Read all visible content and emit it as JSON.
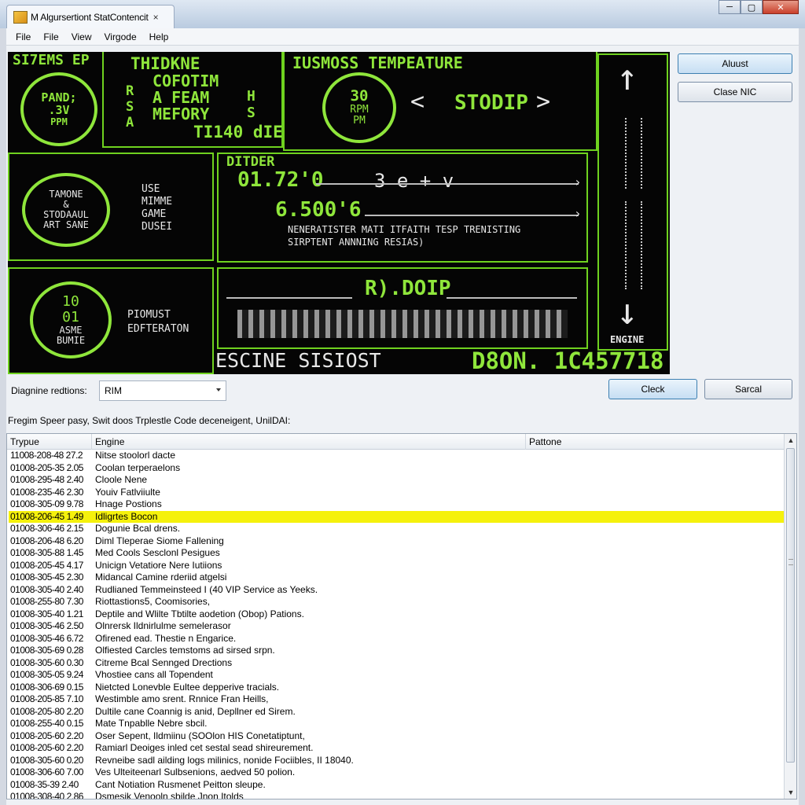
{
  "window": {
    "tab_title": "M Algursertiont StatContencit",
    "tab_close": "×",
    "min": "─",
    "max": "▢",
    "close": "✕"
  },
  "menu": [
    "File",
    "File",
    "View",
    "Virgode",
    "Help"
  ],
  "screen": {
    "p1_title": "SI7EMS EP",
    "p1_gauge": [
      "PAND;",
      ".3V",
      "PPM"
    ],
    "p1b_title": "THIDKNE",
    "p1b_lines": [
      "COFOTIM",
      "A FEAM",
      "MEFORY"
    ],
    "p1b_left": [
      "R",
      "S",
      "A"
    ],
    "p1b_right": [
      "H",
      "S"
    ],
    "p1b_bottom": "TI140 dIE",
    "p2_title": "IUSMOSS TEMPEATURE",
    "p2_gauge": [
      "30",
      "RPM",
      "PM"
    ],
    "p2_stop": "STODIP",
    "p3_gauge": [
      "TAMONE",
      "&",
      "STODAAUL",
      "ART SANE"
    ],
    "p3_text": [
      "USE",
      "MIMME",
      "GAME",
      "DUSEI"
    ],
    "p4_title": "DITDER",
    "p4_val1": "01.72'0",
    "p4_val2": "6.500'6",
    "p4_mid": "3 e + v",
    "p4_line1": "NENERATISTER MATI ITFAITH TESP TRENISTING",
    "p4_line2": "SIRPTENT ANNNING RESIAS)",
    "p5_gauge": [
      "10",
      "01",
      "ASME",
      "BUMIE"
    ],
    "p5_text": [
      "PIOMUST",
      "EDFTERATON"
    ],
    "p6_title": "R).DOIP",
    "side_label": "ENGINE",
    "bottom_left": "ESCINE SISIOST",
    "bottom_right": "D8ON. 1C457718"
  },
  "buttons": {
    "adjust": "Aluust",
    "close_nic": "Clase NIC",
    "check": "Cleck",
    "search": "Sarcal"
  },
  "diagnose": {
    "label": "Diagnine redtions:",
    "value": "RIM"
  },
  "info_line": "Fregim Speer pasy, Swit doos Trplestle Code deceneigent, UnilDAI:",
  "list": {
    "columns": [
      "Trypue",
      "Engine",
      "Pattone"
    ],
    "rows": [
      [
        "11008-208-48 27.2",
        "Nitse stoolorl dacte"
      ],
      [
        "01008-205-35 2.05",
        "Coolan terperaelons"
      ],
      [
        "01008-295-48 2.40",
        "Cloole Nene"
      ],
      [
        "01008-235-46 2.30",
        "Youiv Fatlviiulte"
      ],
      [
        "01008-305-09 9.78",
        "Hnage Postions"
      ],
      [
        "01008-206-45 1.49",
        "Idligrtes Bocon"
      ],
      [
        "01008-306-46 2.15",
        "Dogunie Bcal drens."
      ],
      [
        "01008-206-48 6.20",
        "Diml Tleperae Siome Fallening"
      ],
      [
        "01008-305-88 1.45",
        "Med Cools Sesclonl Pesigues"
      ],
      [
        "01008-205-45 4.17",
        "Unicign Vetatiore Nere Iutiions"
      ],
      [
        "01008-305-45 2.30",
        "Midancal Camine rderiid atgelsi"
      ],
      [
        "01008-305-40 2.40",
        "Rudlianed Temmeinsteed I (40 VIP Service as Yeeks."
      ],
      [
        "01008-255-80 7.30",
        "Riottastions5, Coomisories,"
      ],
      [
        "01008-305-40 1.21",
        "Deptile and Wlilte Tbtilte aodetion (Obop) Pations."
      ],
      [
        "01008-305-46 2.50",
        "Olnrersk Ildnirlulme semelerasor"
      ],
      [
        "01008-305-46 6.72",
        "Ofirened ead. Thestie n Engarice."
      ],
      [
        "01008-305-69 0.28",
        "Olfiested Carcles temstoms ad sirsed srpn."
      ],
      [
        "01008-305-60 0.30",
        "Citreme Bcal Sennged Drections"
      ],
      [
        "01008-305-05 9.24",
        "Vhostiee cans all Topendent"
      ],
      [
        "01008-306-69 0.15",
        "Nietcted Lonevble Eultee depperive tracials."
      ],
      [
        "01008-205-85 7.10",
        "Westimble amo srent. Rnnice Fran Heills,"
      ],
      [
        "01008-205-80 2.20",
        "Dultile cane Coannig is anid, Depllner ed Sirem."
      ],
      [
        "01008-255-40 0.15",
        "Mate Tnpablle Nebre sbcil."
      ],
      [
        "01008-205-60 2.20",
        "Oser Sepent, Ildmiinu (SOOlon HIS Conetatiptunt,"
      ],
      [
        "01008-205-60 2.20",
        "Ramiarl Deoiges inled cet sestal sead shireurement."
      ],
      [
        "01008-305-60 0.20",
        "Revneibe sadl ailding logs milinics, nonide Fociibles, II 18040."
      ],
      [
        "01008-306-60 7.00",
        "Ves Ulteiteenarl Sulbsenions, aedved 50 polion."
      ],
      [
        "01008-35-39 2.40",
        "Cant Notiation Rusmenet Peitton sleupe."
      ],
      [
        "01008-308-40 2.86",
        "Dsmesik Venooln sbilde Jnon Itolds"
      ]
    ],
    "selected_index": 5
  },
  "colors": {
    "screen_bg": "#050505",
    "green": "#8fe63b",
    "selected_row": "#f5f10c"
  }
}
